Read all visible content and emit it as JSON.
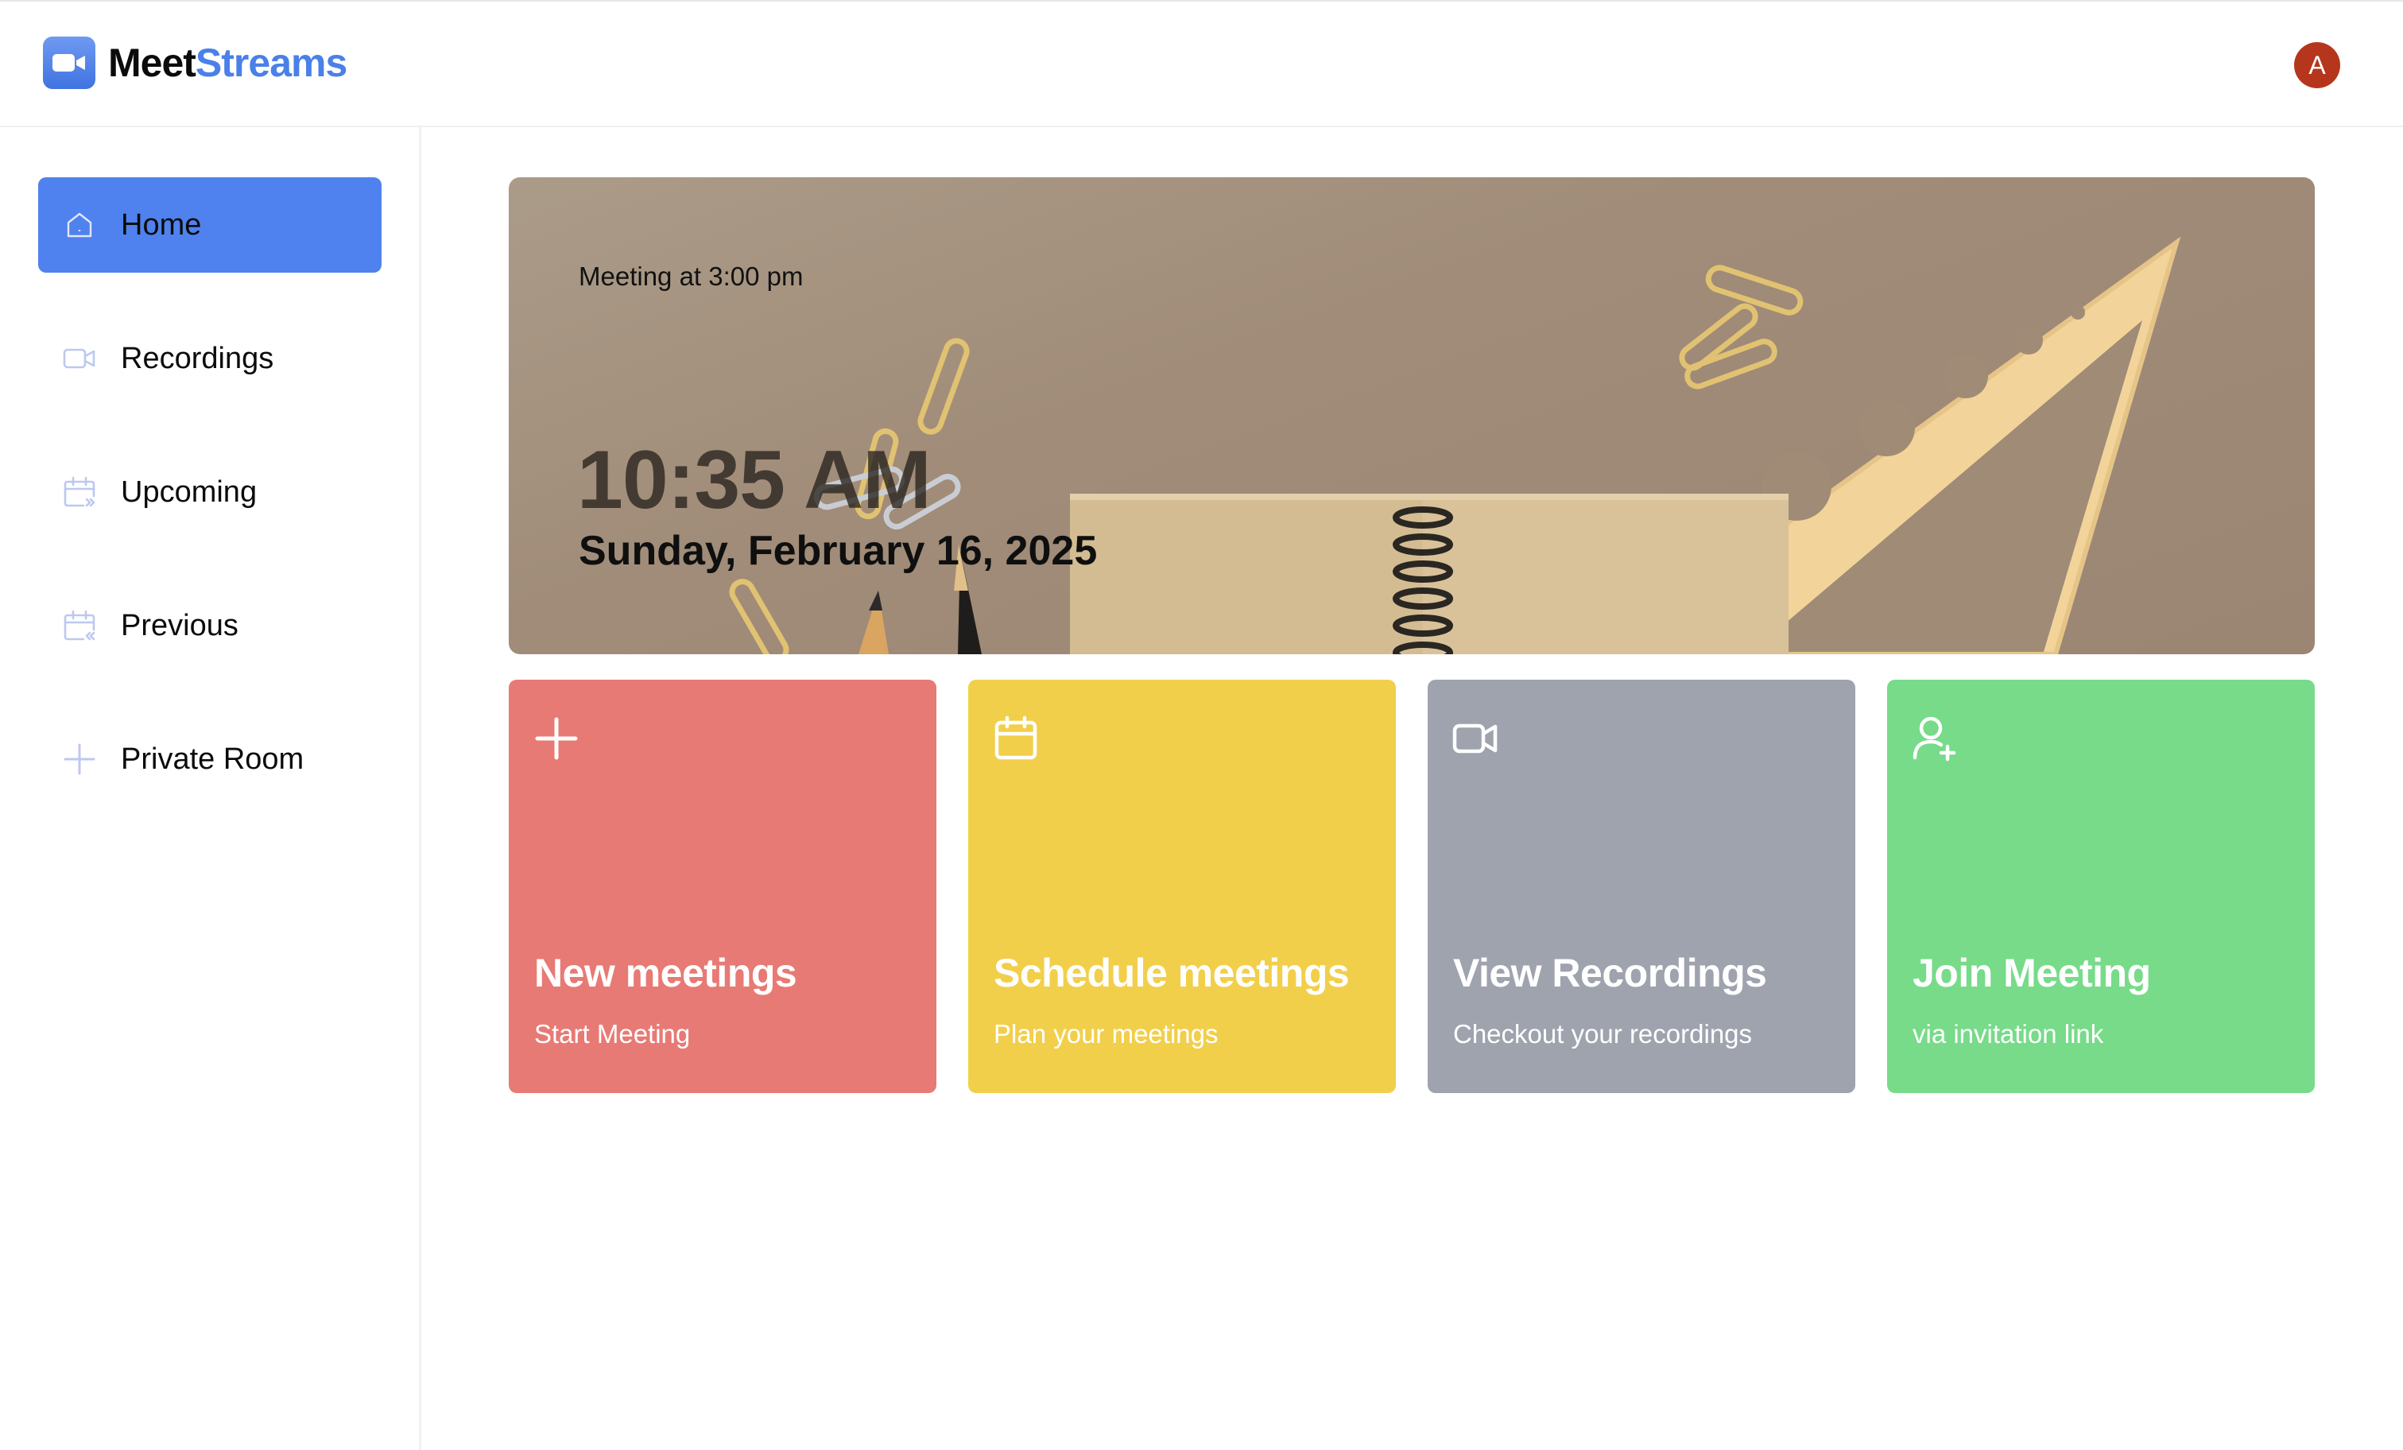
{
  "app": {
    "logo": {
      "part1": "Meet",
      "part2": "Streams",
      "icon": "video-camera-icon"
    },
    "avatar_initial": "A"
  },
  "sidebar": {
    "items": [
      {
        "label": "Home",
        "icon": "home-icon",
        "active": true
      },
      {
        "label": "Recordings",
        "icon": "video-icon",
        "active": false
      },
      {
        "label": "Upcoming",
        "icon": "calendar-upcoming-icon",
        "active": false
      },
      {
        "label": "Previous",
        "icon": "calendar-previous-icon",
        "active": false
      },
      {
        "label": "Private Room",
        "icon": "plus-icon",
        "active": false
      }
    ]
  },
  "hero": {
    "meeting_text": "Meeting at 3:00 pm",
    "time": "10:35 AM",
    "date": "Sunday, February 16, 2025"
  },
  "cards": [
    {
      "title": "New meetings",
      "subtitle": "Start Meeting",
      "icon": "plus-icon",
      "color": "#e77a75"
    },
    {
      "title": "Schedule meetings",
      "subtitle": "Plan your meetings",
      "icon": "calendar-icon",
      "color": "#f2cf4a"
    },
    {
      "title": "View Recordings",
      "subtitle": "Checkout your recordings",
      "icon": "video-icon",
      "color": "#9ea3ae"
    },
    {
      "title": "Join Meeting",
      "subtitle": "via invitation link",
      "icon": "user-plus-icon",
      "color": "#77db89"
    }
  ],
  "colors": {
    "accent": "#4f82ee",
    "brand_blue": "#4a80e8",
    "avatar_bg": "#b5361c",
    "nav_icon": "#bcc9ef"
  }
}
